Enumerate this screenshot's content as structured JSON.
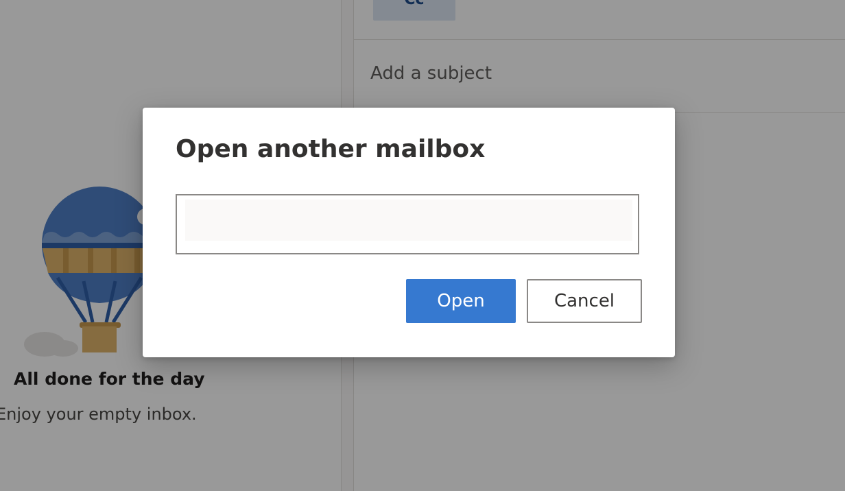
{
  "compose": {
    "cc_label": "Cc",
    "subject_placeholder": "Add a subject"
  },
  "inbox": {
    "empty_title": "All done for the day",
    "empty_subtitle": "Enjoy your empty inbox."
  },
  "dialog": {
    "title": "Open another mailbox",
    "input_value": "",
    "open_label": "Open",
    "cancel_label": "Cancel"
  },
  "colors": {
    "primary": "#3679d0",
    "overlay": "rgba(0,0,0,0.4)",
    "balloon_blue": "#4f7fc7",
    "balloon_tan": "#e0b46b"
  }
}
